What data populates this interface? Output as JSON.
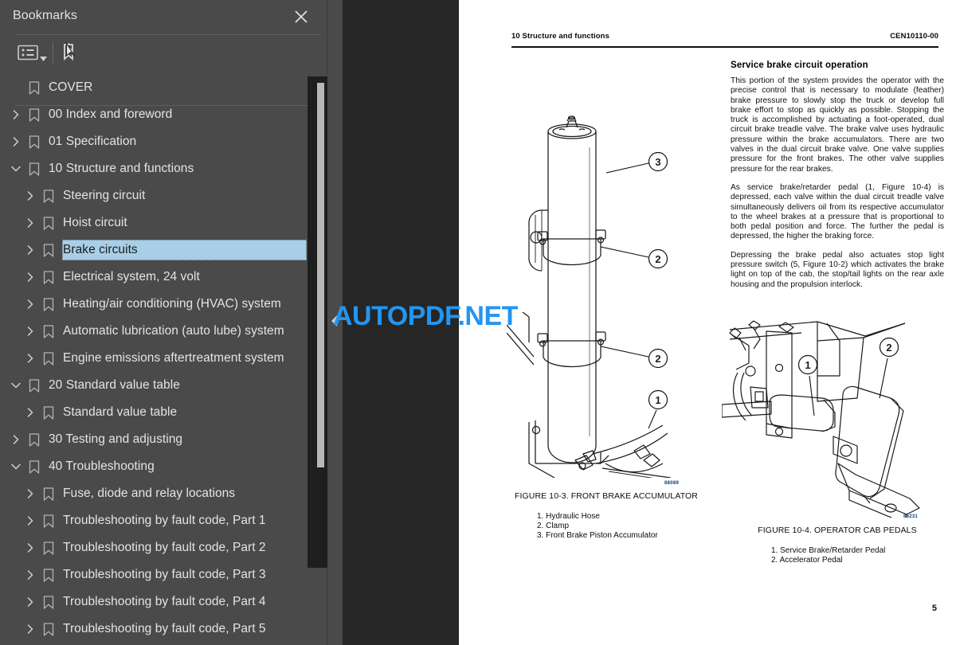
{
  "sidebar": {
    "title": "Bookmarks",
    "close_icon": "close-icon",
    "toolbar": {
      "options_icon": "list-options-icon",
      "caret_icon": "chevron-down-icon",
      "bookmark_icon": "new-bookmark-icon"
    },
    "items": [
      {
        "label": "COVER",
        "level": 0,
        "twisty": "none",
        "selected": false
      },
      {
        "label": "00 Index and foreword",
        "level": 0,
        "twisty": "collapsed",
        "selected": false
      },
      {
        "label": "01 Specification",
        "level": 0,
        "twisty": "collapsed",
        "selected": false
      },
      {
        "label": "10 Structure and functions",
        "level": 0,
        "twisty": "expanded",
        "selected": false
      },
      {
        "label": "Steering circuit",
        "level": 1,
        "twisty": "collapsed",
        "selected": false
      },
      {
        "label": "Hoist circuit",
        "level": 1,
        "twisty": "collapsed",
        "selected": false
      },
      {
        "label": "Brake circuits",
        "level": 1,
        "twisty": "collapsed",
        "selected": true
      },
      {
        "label": "Electrical system, 24 volt",
        "level": 1,
        "twisty": "collapsed",
        "selected": false
      },
      {
        "label": "Heating/air conditioning (HVAC) system",
        "level": 1,
        "twisty": "collapsed",
        "selected": false
      },
      {
        "label": "Automatic lubrication (auto lube) system",
        "level": 1,
        "twisty": "collapsed",
        "selected": false
      },
      {
        "label": "Engine emissions aftertreatment system",
        "level": 1,
        "twisty": "collapsed",
        "selected": false
      },
      {
        "label": "20 Standard value table",
        "level": 0,
        "twisty": "expanded",
        "selected": false
      },
      {
        "label": "Standard value table",
        "level": 1,
        "twisty": "collapsed",
        "selected": false
      },
      {
        "label": "30 Testing and adjusting",
        "level": 0,
        "twisty": "collapsed",
        "selected": false
      },
      {
        "label": "40 Troubleshooting",
        "level": 0,
        "twisty": "expanded",
        "selected": false
      },
      {
        "label": "Fuse, diode and relay locations",
        "level": 1,
        "twisty": "collapsed",
        "selected": false
      },
      {
        "label": "Troubleshooting by fault code, Part 1",
        "level": 1,
        "twisty": "collapsed",
        "selected": false
      },
      {
        "label": "Troubleshooting by fault code, Part 2",
        "level": 1,
        "twisty": "collapsed",
        "selected": false
      },
      {
        "label": "Troubleshooting by fault code, Part 3",
        "level": 1,
        "twisty": "collapsed",
        "selected": false
      },
      {
        "label": "Troubleshooting by fault code, Part 4",
        "level": 1,
        "twisty": "collapsed",
        "selected": false
      },
      {
        "label": "Troubleshooting by fault code, Part 5",
        "level": 1,
        "twisty": "collapsed",
        "selected": false
      }
    ]
  },
  "watermark": {
    "text": "AUTOPDF.NET",
    "color": "#2196f3"
  },
  "document": {
    "header_left": "10 Structure and functions",
    "header_right": "CEN10110-00",
    "page_number": "5",
    "section_title": "Service brake circuit operation",
    "paragraphs": [
      "This portion of the system provides the operator with the precise control that is necessary to modulate (feather) brake pressure to slowly stop the truck or develop full brake effort to stop as quickly as possible. Stopping the truck is accomplished by actuating a foot-operated, dual circuit brake treadle valve. The brake valve uses hydraulic pressure within the brake accumulators. There are two valves in the dual circuit brake valve. One valve supplies pressure for the front brakes. The other valve supplies pressure for the rear brakes.",
      "As service brake/retarder pedal (1, Figure 10-4) is depressed, each valve within the dual circuit treadle valve simultaneously delivers oil from its respective accumulator to the wheel brakes at a pressure that is proportional to both pedal position and force. The further the pedal is depressed, the higher the braking force.",
      "Depressing the brake pedal also actuates stop light pressure switch (5, Figure 10-2) which activates the brake light on top of the cab, the stop/tail lights on the rear axle housing and the propulsion interlock."
    ],
    "figure_left": {
      "code": "88089",
      "caption": "FIGURE 10-3. FRONT BRAKE ACCUMULATOR",
      "callouts": [
        "3",
        "2",
        "2",
        "1"
      ],
      "items": [
        "1. Hydraulic Hose",
        "2. Clamp",
        "3. Front Brake Piston Accumulator"
      ]
    },
    "figure_right": {
      "code": "86231",
      "caption": "FIGURE 10-4. OPERATOR CAB PEDALS",
      "callouts": [
        "1",
        "2"
      ],
      "items": [
        "1. Service Brake/Retarder Pedal",
        "2. Accelerator Pedal"
      ]
    }
  }
}
